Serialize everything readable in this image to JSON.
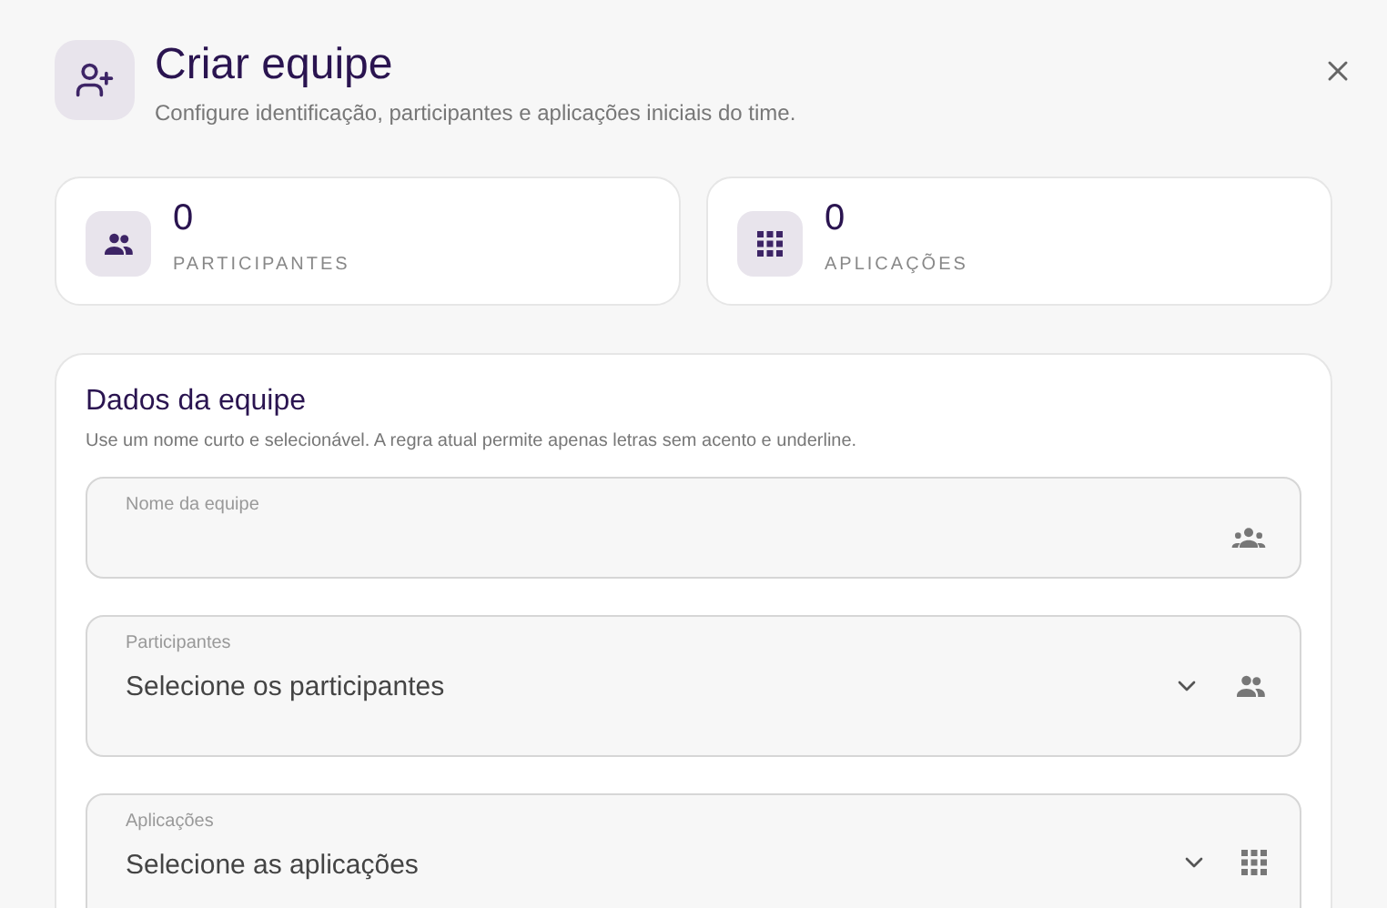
{
  "dialog": {
    "title": "Criar equipe",
    "subtitle": "Configure identificação, participantes e aplicações iniciais do time."
  },
  "stats": [
    {
      "value": "0",
      "label": "PARTICIPANTES"
    },
    {
      "value": "0",
      "label": "APLICAÇÕES"
    }
  ],
  "form": {
    "title": "Dados da equipe",
    "hint": "Use um nome curto e selecionável. A regra atual permite apenas letras sem acento e underline.",
    "fields": [
      {
        "kind": "text",
        "label": "Nome da equipe"
      },
      {
        "kind": "select",
        "label": "Participantes",
        "placeholder": "Selecione os participantes"
      },
      {
        "kind": "select",
        "label": "Aplicações",
        "placeholder": "Selecione as aplicações"
      }
    ]
  }
}
